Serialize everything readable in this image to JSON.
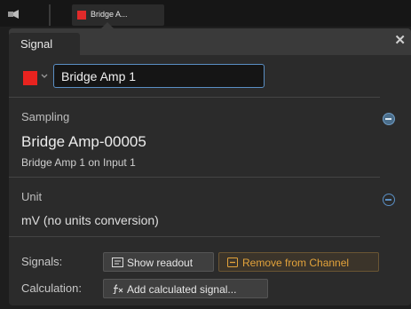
{
  "channel_tab": {
    "label": "Bridge A..."
  },
  "popover": {
    "tab_label": "Signal",
    "close_glyph": "✕"
  },
  "signal_name": {
    "value": "Bridge Amp 1",
    "color": "#e8231f"
  },
  "sampling": {
    "title": "Sampling",
    "name": "Bridge Amp-00005",
    "description": "Bridge Amp 1 on Input 1"
  },
  "unit": {
    "title": "Unit",
    "value": "mV (no units conversion)"
  },
  "signals_row": {
    "label": "Signals:",
    "show_readout": "Show readout",
    "remove_from_channel": "Remove from Channel"
  },
  "calculation_row": {
    "label": "Calculation:",
    "add_calculated": "Add calculated signal..."
  },
  "icons": {
    "top": "scope-icon",
    "options": "more-options-icon",
    "readout": "readout-icon",
    "remove": "remove-icon",
    "function": "function-icon"
  },
  "colors": {
    "accent": "#5a8fc4",
    "warning": "#e3a33b",
    "channel": "#e02a2a"
  }
}
